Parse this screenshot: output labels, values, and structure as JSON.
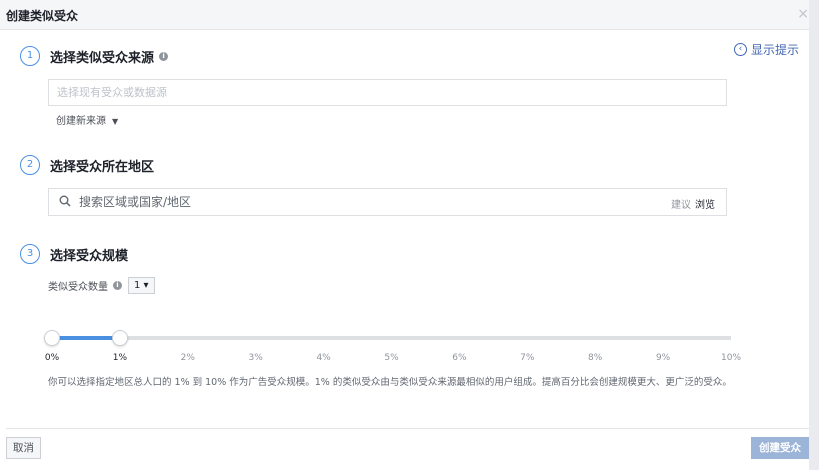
{
  "dialog": {
    "title": "创建类似受众",
    "close_symbol": "×",
    "show_hint_label": "显示提示",
    "hint_icon_symbol": "‹"
  },
  "steps": [
    {
      "number": "1",
      "title": "选择类似受众来源"
    },
    {
      "number": "2",
      "title": "选择受众所在地区"
    },
    {
      "number": "3",
      "title": "选择受众规模"
    }
  ],
  "source": {
    "placeholder": "选择现有受众或数据源",
    "create_new_label": "创建新来源",
    "caret": "▼"
  },
  "location": {
    "search_placeholder": "搜索区域或国家/地区",
    "suggest_label": "建议",
    "browse_label": "浏览"
  },
  "size": {
    "count_label": "类似受众数量",
    "count_value": "1 ▾",
    "range_start_percent": 0,
    "range_end_percent": 1,
    "ticks": [
      "0%",
      "1%",
      "2%",
      "3%",
      "4%",
      "5%",
      "6%",
      "7%",
      "8%",
      "9%",
      "10%"
    ],
    "description": "你可以选择指定地区总人口的 1% 到 10% 作为广告受众规模。1% 的类似受众由与类似受众来源最相似的用户组成。提高百分比会创建规模更大、更广泛的受众。"
  },
  "footer": {
    "cancel_label": "取消",
    "create_label": "创建受众"
  },
  "colors": {
    "accent": "#4a90e2",
    "link": "#4267b2",
    "create_button_disabled": "#9cb4d8"
  }
}
